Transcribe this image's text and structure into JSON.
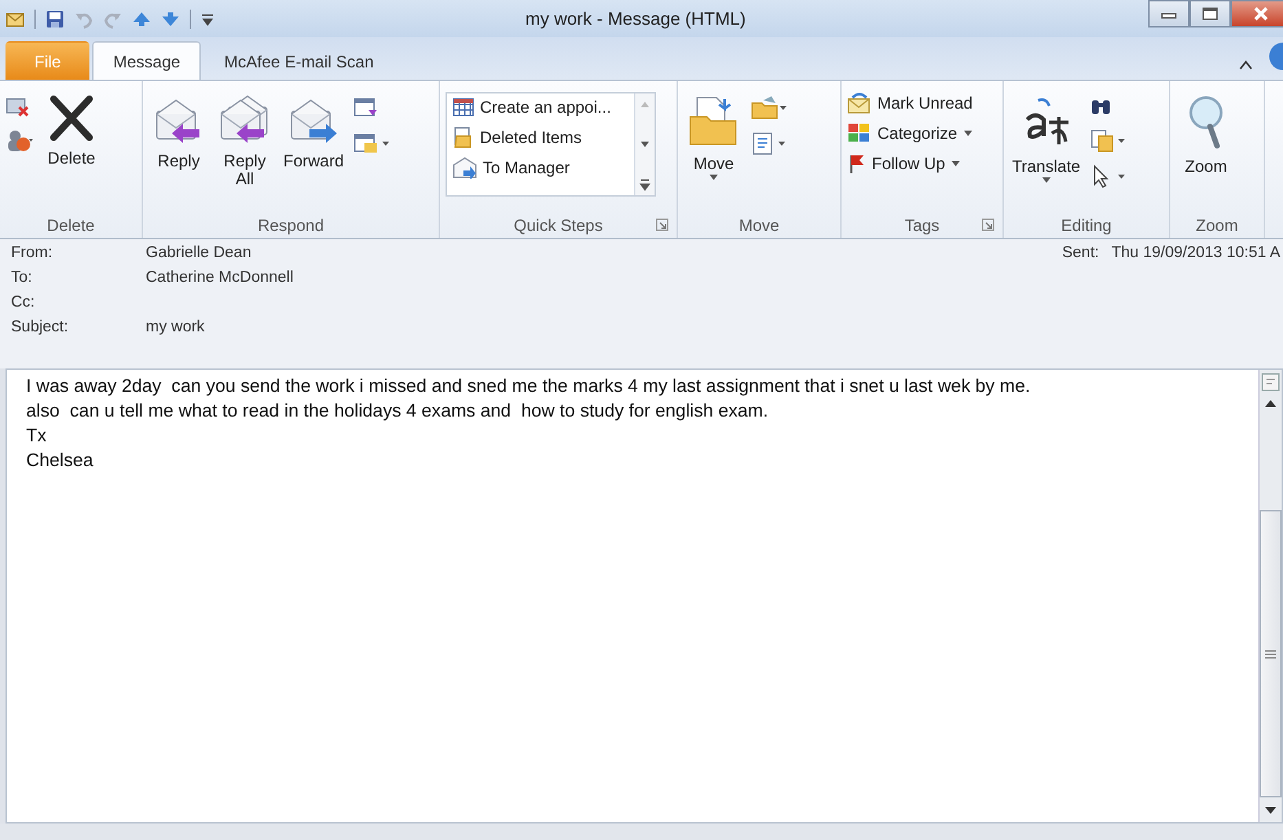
{
  "window": {
    "title": "my work - Message (HTML)"
  },
  "tabs": [
    {
      "label": "File",
      "kind": "file",
      "selected": false
    },
    {
      "label": "Message",
      "kind": "tab",
      "selected": true
    },
    {
      "label": "McAfee E-mail Scan",
      "kind": "tab",
      "selected": false
    }
  ],
  "ribbon_groups": [
    {
      "label": "Delete",
      "items": [
        {
          "kind": "icons"
        },
        {
          "kind": "large",
          "label": "Delete"
        }
      ]
    },
    {
      "label": "Respond",
      "items": [
        {
          "kind": "large",
          "label": "Reply"
        },
        {
          "kind": "large",
          "label": "Reply All"
        },
        {
          "kind": "large",
          "label": "Forward"
        },
        {
          "kind": "icons"
        }
      ]
    },
    {
      "label": "Quick Steps",
      "items": [
        {
          "kind": "gallery",
          "entries": [
            "Create an appoi...",
            "Deleted Items",
            "To Manager"
          ]
        }
      ]
    },
    {
      "label": "Move",
      "items": [
        {
          "kind": "large",
          "label": "Move"
        },
        {
          "kind": "icons"
        }
      ]
    },
    {
      "label": "Tags",
      "items": [
        {
          "kind": "smalls",
          "entries": [
            "Mark Unread",
            "Categorize",
            "Follow Up"
          ]
        }
      ]
    },
    {
      "label": "Editing",
      "items": [
        {
          "kind": "large",
          "label": "Translate"
        },
        {
          "kind": "icons"
        }
      ]
    },
    {
      "label": "Zoom",
      "items": [
        {
          "kind": "large",
          "label": "Zoom"
        }
      ]
    }
  ],
  "header": {
    "fields": [
      {
        "label": "From:",
        "value": "Gabrielle Dean"
      },
      {
        "label": "To:",
        "value": "Catherine McDonnell"
      },
      {
        "label": "Cc:"
      },
      {
        "label": "Subject:",
        "value": "my work"
      }
    ],
    "sent": {
      "label": "Sent:",
      "value": "Thu 19/09/2013 10:51 A"
    }
  },
  "body": {
    "lines": [
      "I was away 2day  can you send the work i missed and sned me the marks 4 my last assignment that i snet u last wek by me.",
      "also  can u tell me what to read in the holidays 4 exams and  how to study for english exam.",
      "Tx",
      "Chelsea"
    ]
  }
}
